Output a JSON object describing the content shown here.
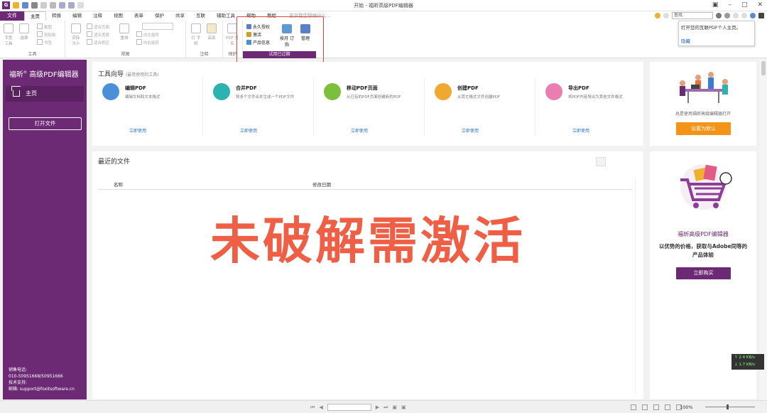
{
  "window": {
    "title": "开始 - 福昕高级PDF编辑器",
    "logo": "G"
  },
  "menu": {
    "file": "文件",
    "tabs": [
      "主页",
      "转换",
      "编辑",
      "注释",
      "视图",
      "表单",
      "保护",
      "共享",
      "互联",
      "辅助工具",
      "帮助",
      "教程"
    ],
    "tell_me": "告诉我您想做什么...",
    "search_placeholder": "查找"
  },
  "ribbon": {
    "groups": {
      "tools": "工具",
      "view": "视图",
      "comment": "注释",
      "protect": "保护"
    },
    "hand_tool": "手型\n工具",
    "select": "选择",
    "snapshot": "截图",
    "clipboard": "剪贴板",
    "bookmark": "书签",
    "actual_size": "实际\n大小",
    "fit_page": "适合页面",
    "fit_width": "适合宽度",
    "fit_visible": "适合视区",
    "reflow": "重排",
    "rotate_left": "向左旋转",
    "rotate_right": "向右旋转",
    "typewriter": "打\n字机",
    "highlight": "高亮",
    "pdf_sign": "PDF\n签名",
    "protect": "保护"
  },
  "license": {
    "permanent": "永久授权",
    "activate": "激活",
    "product_info": "产品信息",
    "subscribe": "按月\n订购",
    "manage": "管理",
    "status": "试用已过期"
  },
  "tooltip": {
    "text": "打开您的互联PDF个人主页。",
    "link": "隐藏"
  },
  "sidebar": {
    "brand": "福昕",
    "brand_sup": "®",
    "brand_suffix": "高级PDF编辑器",
    "home": "主页",
    "open_file": "打开文件",
    "sales_label": "销售电话:",
    "sales_phone": "010-50951668/50951666",
    "support_label": "技术支持:",
    "email": "邮箱: support@foxitsoftware.cn"
  },
  "tool_guide": {
    "title": "工具向导",
    "subtitle": "(最常使用的工具)",
    "tools": [
      {
        "name": "编辑PDF",
        "desc": "编辑文档和文本格式",
        "link": "立即使用",
        "color": "#4a90d9"
      },
      {
        "name": "合并PDF",
        "desc": "将多个文件合并生成一个PDF文件",
        "link": "立即使用",
        "color": "#2bb3b1"
      },
      {
        "name": "移动PDF页面",
        "desc": "从已有的PDF页面创建新的PDF",
        "link": "立即使用",
        "color": "#7cbf3c"
      },
      {
        "name": "创建PDF",
        "desc": "从其它格式文件创建PDF",
        "link": "立即使用",
        "color": "#f0a830"
      },
      {
        "name": "导出PDF",
        "desc": "将PDF内容导出为其他文件格式",
        "link": "立即使用",
        "color": "#e97fb0"
      }
    ]
  },
  "recent": {
    "title": "最近的文件",
    "col_name": "名称",
    "col_date": "修改日期",
    "watermark": "未破解需激活"
  },
  "promo1": {
    "text": "总是使用福昕高级编辑器打开",
    "button": "设置为默认"
  },
  "promo2": {
    "name": "福昕高级PDF编辑器",
    "desc": "以优势的价格，获取与Adobe同等的产品体验",
    "button": "立即购买"
  },
  "speed": {
    "up": "↑ 2.4 KB/s",
    "down": "↓ 1.7 KB/s"
  },
  "statusbar": {
    "zoom": "100%"
  }
}
